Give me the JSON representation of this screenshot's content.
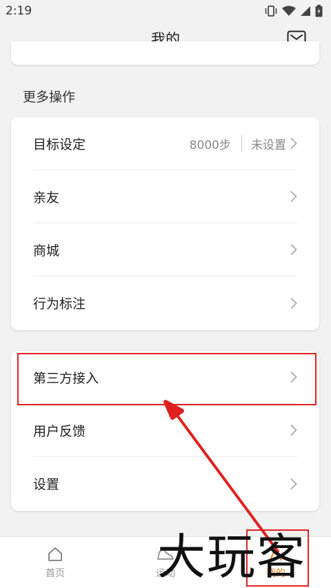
{
  "status_bar": {
    "time": "2:19"
  },
  "header": {
    "title": "我的"
  },
  "section": {
    "title": "更多操作"
  },
  "settings_group_1": [
    {
      "label": "目标设定",
      "value": "8000步",
      "status": "未设置"
    },
    {
      "label": "亲友"
    },
    {
      "label": "商城"
    },
    {
      "label": "行为标注"
    }
  ],
  "settings_group_2": [
    {
      "label": "第三方接入"
    },
    {
      "label": "用户反馈"
    },
    {
      "label": "设置"
    }
  ],
  "tabs": [
    {
      "label": "首页",
      "icon": "home-icon"
    },
    {
      "label": "运动",
      "icon": "shoe-icon"
    },
    {
      "label": "我的",
      "icon": "profile-icon",
      "active": true
    }
  ],
  "watermark": {
    "text": "大玩客"
  },
  "colors": {
    "accent": "#f08022",
    "annotation": "#e02020"
  }
}
